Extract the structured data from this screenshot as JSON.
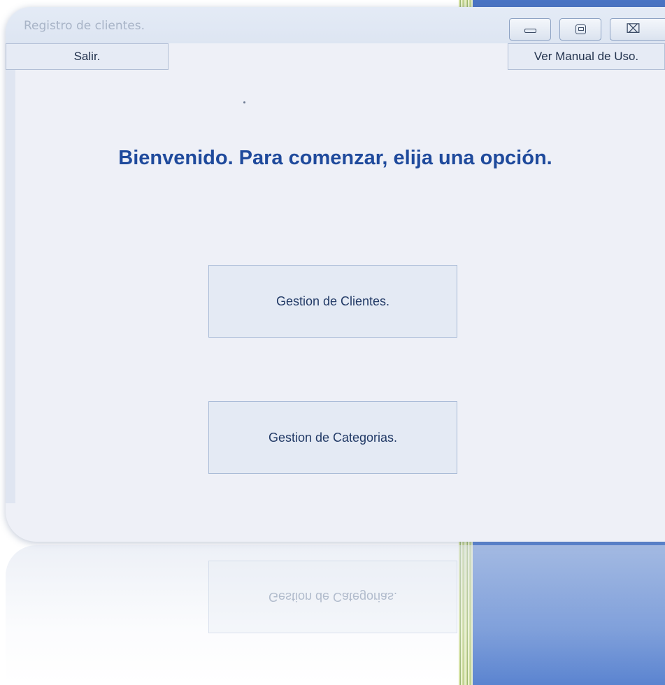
{
  "window": {
    "title": "Registro de clientes."
  },
  "menu": {
    "exit_label": "Salir.",
    "manual_label": "Ver Manual de Uso."
  },
  "main": {
    "welcome": "Bienvenido. Para comenzar, elija una opción.",
    "clients_button": "Gestion de Clientes.",
    "categories_button": "Gestion de Categorias."
  },
  "icons": {
    "minimize": "minimize-icon",
    "maximize": "maximize-icon",
    "close": "close-icon"
  },
  "colors": {
    "accent_text": "#1f4a9c",
    "backdrop_blue": "#4a74c4"
  }
}
